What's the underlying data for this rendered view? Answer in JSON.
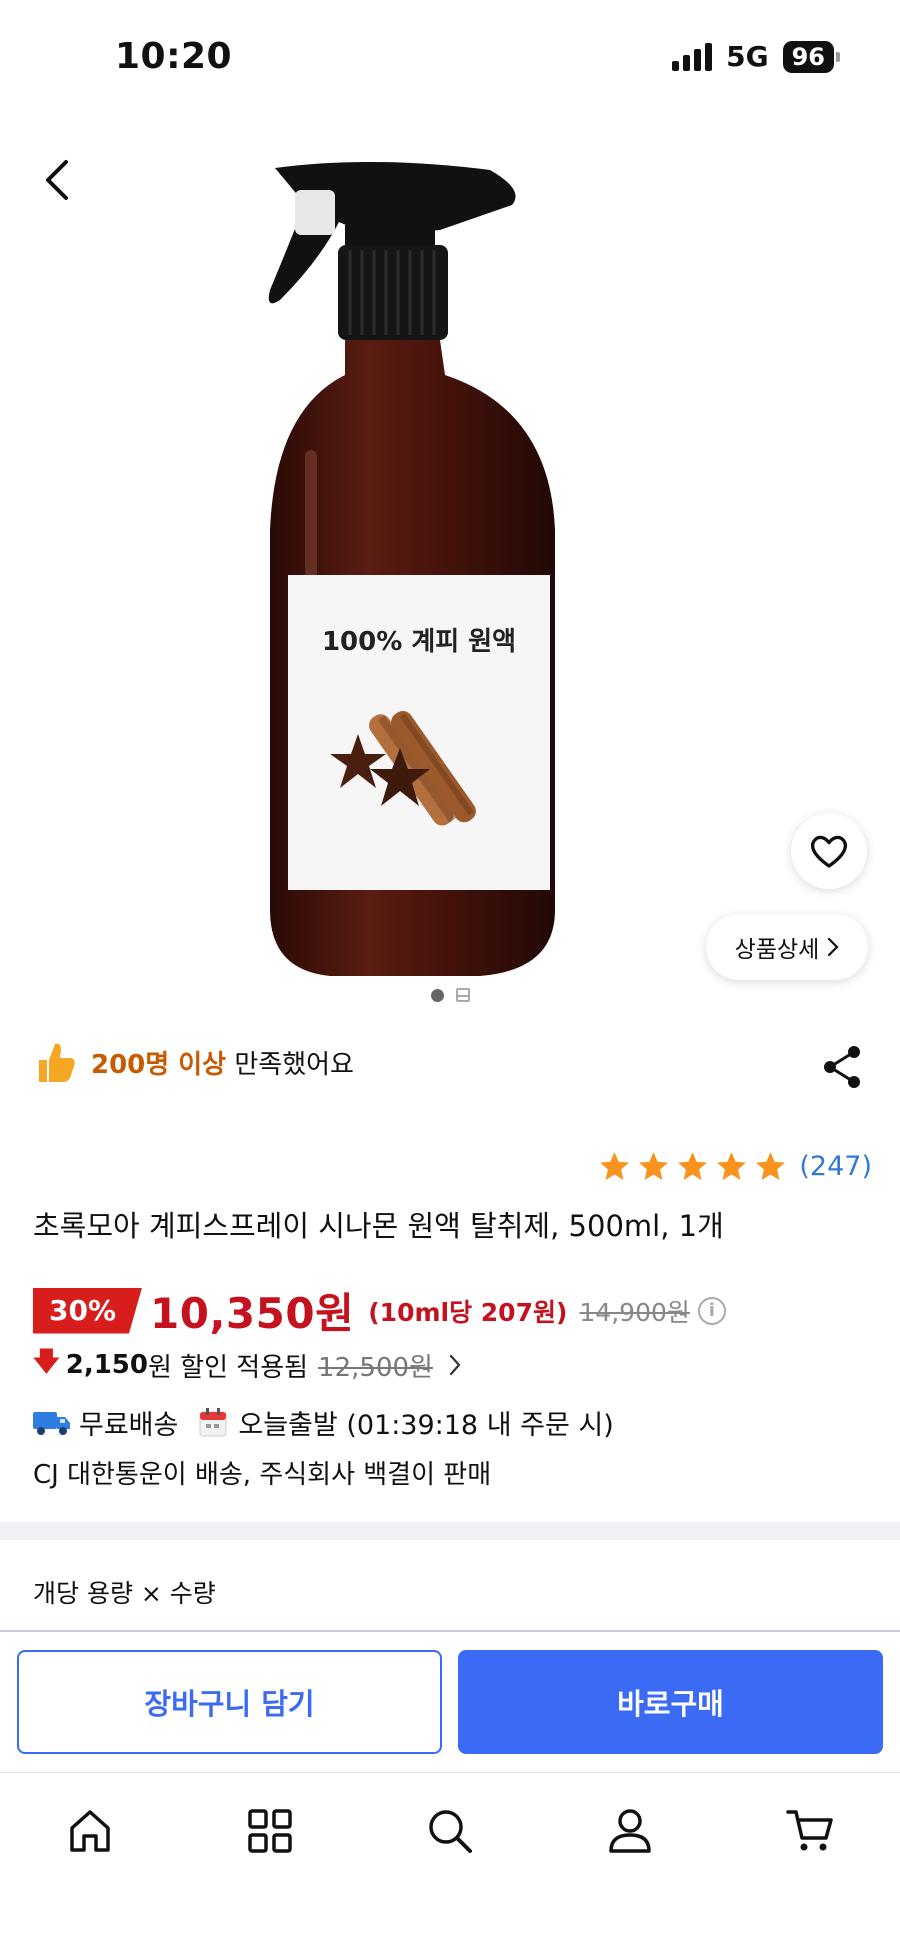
{
  "status_bar": {
    "time": "10:20",
    "network": "5G",
    "battery": "96"
  },
  "product_image": {
    "label_text": "100% 계피 원액"
  },
  "detail_button_label": "상품상세",
  "satisfaction": {
    "emphasis": "200명 이상",
    "text": "만족했어요"
  },
  "rating": {
    "stars": 5,
    "review_count": "(247)",
    "star_color": "#f7931e"
  },
  "product_title": "초록모아 계피스프레이 시나몬 원액 탈취제, 500ml, 1개",
  "price": {
    "discount": "30%",
    "sale_price": "10,350원",
    "unit_price": "(10ml당 207원)",
    "original_price": "14,900원",
    "info_icon": "i"
  },
  "coupon": {
    "amount": "2,150",
    "amount_suffix": "원 할인 적용됨",
    "strike_price": "12,500원"
  },
  "shipping": {
    "free_shipping": "무료배송",
    "today_shipping": "오늘출발 (01:39:18 내 주문 시)",
    "seller_line": "CJ 대한통운이 배송, 주식회사 백결이 판매"
  },
  "option_label": "개당 용량 × 수량",
  "buttons": {
    "cart": "장바구니 담기",
    "buy_now": "바로구매"
  },
  "colors": {
    "accent_blue": "#3b6af5",
    "price_red": "#c5121f",
    "badge_red": "#d81d1d",
    "satisfaction_orange": "#c85a00"
  },
  "bottom_nav": {
    "items": [
      "home-icon",
      "category-grid-icon",
      "search-icon",
      "my-page-icon",
      "cart-icon"
    ]
  }
}
